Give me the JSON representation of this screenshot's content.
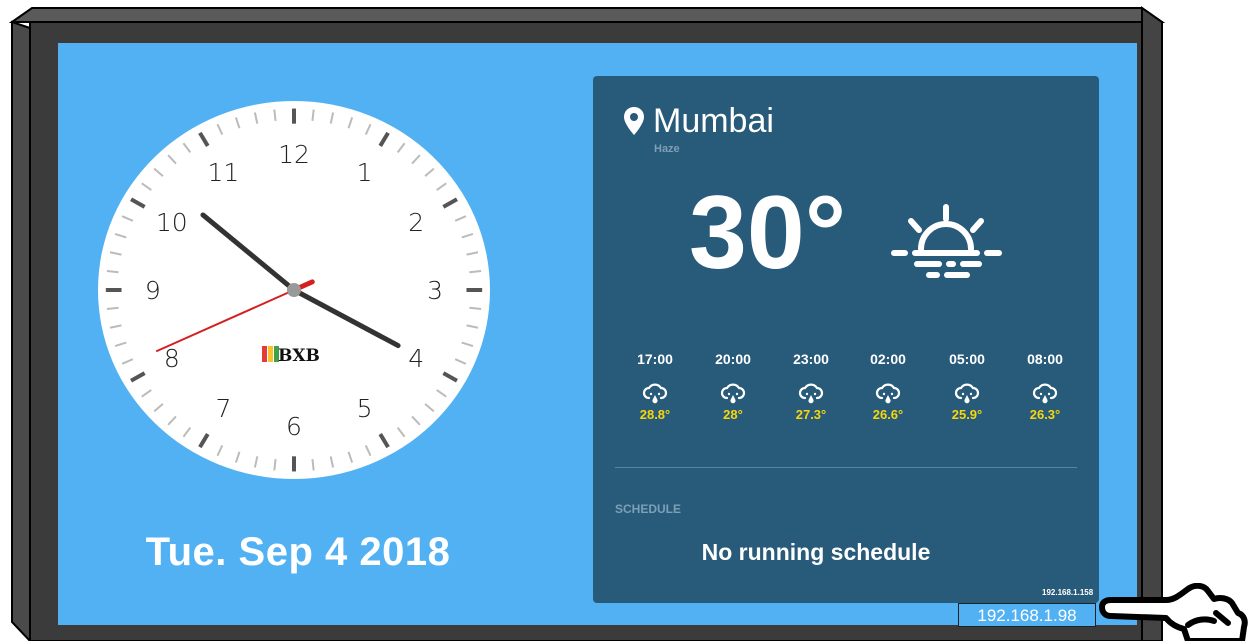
{
  "clock": {
    "numerals": [
      "12",
      "1",
      "2",
      "3",
      "4",
      "5",
      "6",
      "7",
      "8",
      "9",
      "10",
      "11"
    ],
    "logo_text": "BXB",
    "time": {
      "hour": 10,
      "minute": 19,
      "second": 41
    }
  },
  "date": "Tue. Sep 4 2018",
  "weather": {
    "city": "Mumbai",
    "condition": "Haze",
    "temperature": "30°",
    "icon": "sunrise-haze-icon",
    "forecast": [
      {
        "time": "17:00",
        "temp": "28.8°",
        "icon": "cloud-rain-icon"
      },
      {
        "time": "20:00",
        "temp": "28°",
        "icon": "cloud-rain-icon"
      },
      {
        "time": "23:00",
        "temp": "27.3°",
        "icon": "cloud-rain-icon"
      },
      {
        "time": "02:00",
        "temp": "26.6°",
        "icon": "cloud-rain-icon"
      },
      {
        "time": "05:00",
        "temp": "25.9°",
        "icon": "cloud-rain-icon"
      },
      {
        "time": "08:00",
        "temp": "26.3°",
        "icon": "cloud-rain-icon"
      }
    ]
  },
  "schedule": {
    "label": "SCHEDULE",
    "status": "No running schedule"
  },
  "network": {
    "ip_small": "192.168.1.158",
    "ip_label": "192.168.1.98"
  },
  "colors": {
    "screen": "#52b1f3",
    "panel": "#285a7a",
    "forecast_temp": "#f7d70d",
    "second_hand": "#d42020"
  }
}
